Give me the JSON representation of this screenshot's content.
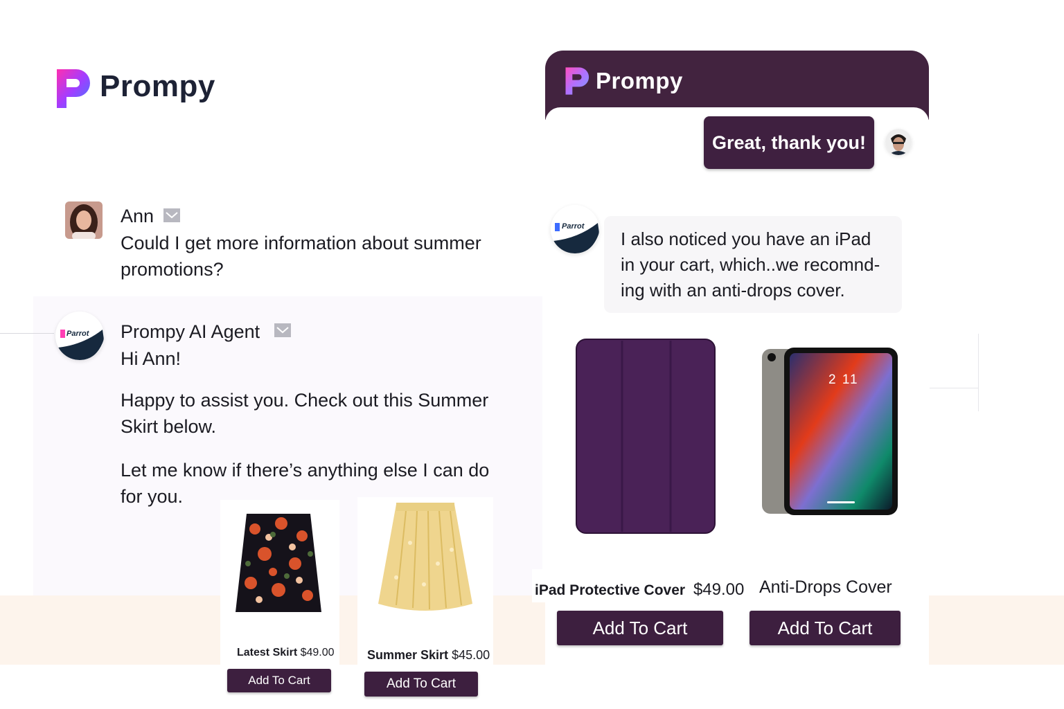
{
  "brand": {
    "name": "Prompy",
    "bot_badge": "Parrot"
  },
  "conversation": {
    "user_name": "Ann",
    "user_message": "Could I get more information about summer promotions?",
    "agent_name": "Prompy AI Agent",
    "agent_greeting": "Hi Ann!",
    "agent_paragraph_1": "Happy to assist you. Check out this Summer Skirt below.",
    "agent_paragraph_2": "Let me know if there’s anything else I can do for you."
  },
  "skirts": [
    {
      "name": "Latest Skirt",
      "price": "$49.00",
      "button": "Add To Cart"
    },
    {
      "name": "Summer Skirt",
      "price": "$45.00",
      "button": "Add To Cart"
    }
  ],
  "chat_window": {
    "title": "Prompy",
    "user_bubble": "Great, thank you!",
    "bot_message": "I also noticed you have an iPad in your cart, which..we recomnd-ing with an anti-drops cover.",
    "ipad_screen_time": "2 11",
    "products": [
      {
        "name": "iPad Protective Cover",
        "price": "$49.00",
        "button": "Add To Cart"
      },
      {
        "name": "Anti-Drops Cover",
        "price": "",
        "button": "Add To Cart"
      }
    ]
  },
  "colors": {
    "accent": "#3f2040",
    "header": "#42233f",
    "peach": "#fdf4ec"
  }
}
